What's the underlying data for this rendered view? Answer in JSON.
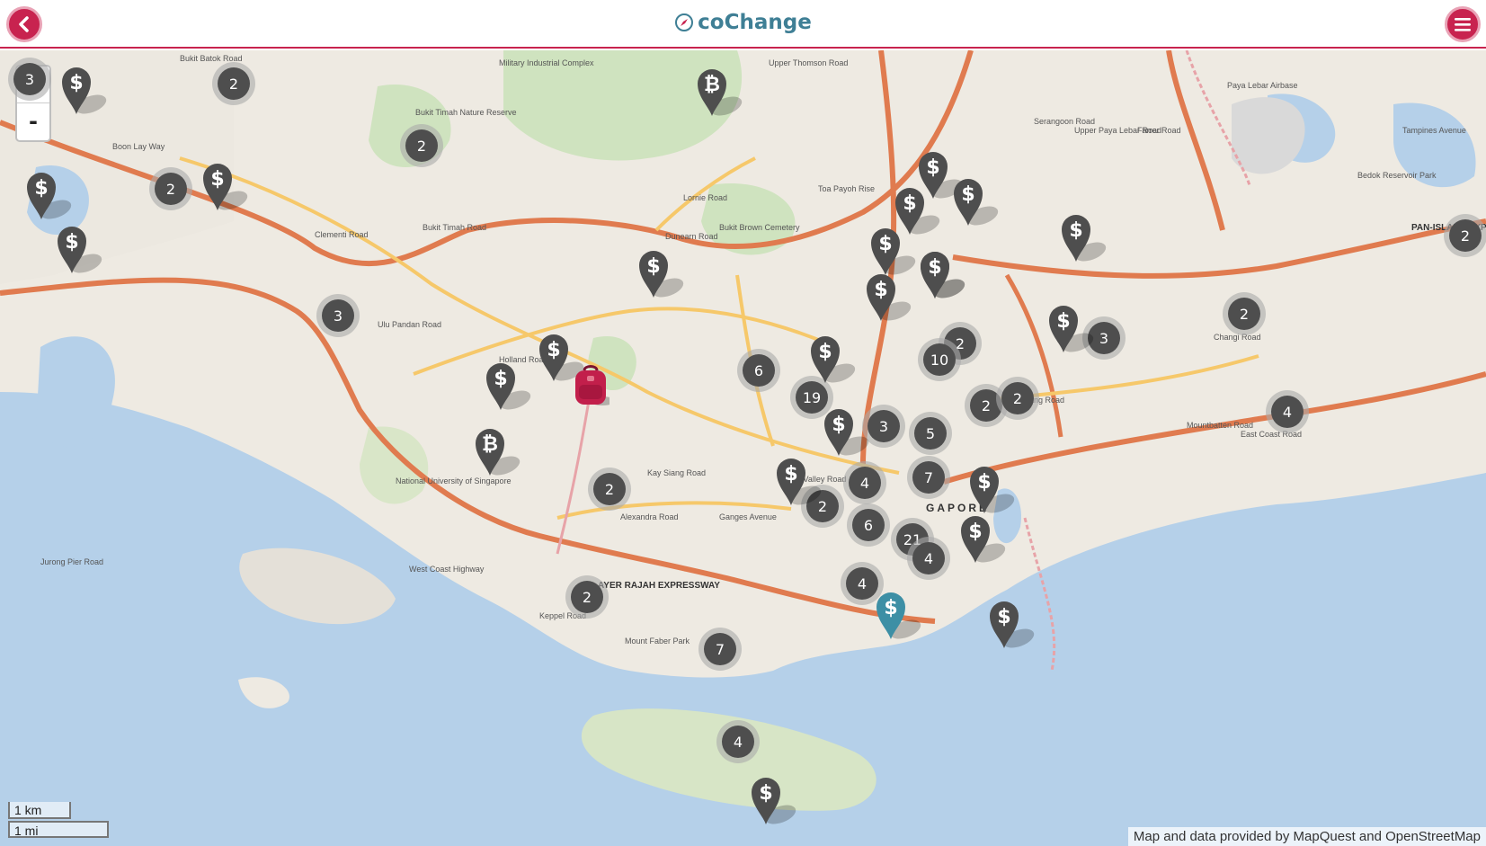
{
  "header": {
    "title": "coChange",
    "back_icon": "back-arrow-icon",
    "menu_icon": "hamburger-menu-icon",
    "accent": "#c8234f",
    "title_color": "#3f7f95"
  },
  "map": {
    "zoom_in": "+",
    "zoom_out": "-",
    "scale_km": "1 km",
    "scale_mi": "1 mi",
    "attribution": "Map and data provided by MapQuest and OpenStreetMap",
    "labels": [
      "Bukit Timah Road",
      "Holland Road",
      "Ulu Pandan Road",
      "Alexandra Road",
      "AYER RAJAH EXPRESSWAY",
      "West Coast Highway",
      "Clementi Road",
      "River Valley Road",
      "Ganges Avenue",
      "Dunearn Road",
      "Bukit Brown Cemetery",
      "PAN-ISLAND EXPRESSWAY",
      "Kallang Road",
      "Mountbatten Road",
      "East Coast Road",
      "Keppel Road",
      "Mount Faber Park",
      "Kay Siang Road",
      "National University of Singapore",
      "GAPORE",
      "Bukit Timah Nature Reserve",
      "Tampines Avenue",
      "Bedok Reservoir Park",
      "Paya Lebar Airbase",
      "Upper Thomson Road",
      "Lornie Road",
      "Serangoon Road",
      "Farrer Road",
      "Boon Lay Way",
      "Jurong Pier Road",
      "Bukit Batok Road",
      "Upper Paya Lebar Road",
      "Changi Road",
      "Toa Payoh Rise",
      "Military Industrial Complex"
    ],
    "clusters": [
      3,
      2,
      2,
      2,
      3,
      2,
      6,
      19,
      3,
      5,
      2,
      10,
      2,
      2,
      3,
      2,
      2,
      4,
      4,
      2,
      6,
      7,
      21,
      4,
      4,
      2,
      7,
      4
    ],
    "markers": [
      {
        "type": "dollar",
        "color": "#4e4e4e"
      },
      {
        "type": "dollar",
        "color": "#4e4e4e"
      },
      {
        "type": "dollar",
        "color": "#4e4e4e"
      },
      {
        "type": "dollar",
        "color": "#4e4e4e"
      },
      {
        "type": "bitcoin",
        "color": "#4e4e4e"
      },
      {
        "type": "dollar",
        "color": "#4e4e4e"
      },
      {
        "type": "dollar",
        "color": "#4e4e4e"
      },
      {
        "type": "dollar",
        "color": "#4e4e4e"
      },
      {
        "type": "bitcoin",
        "color": "#4e4e4e"
      },
      {
        "type": "dollar",
        "color": "#4e4e4e"
      },
      {
        "type": "dollar",
        "color": "#4e4e4e"
      },
      {
        "type": "dollar",
        "color": "#4e4e4e"
      },
      {
        "type": "dollar",
        "color": "#4e4e4e"
      },
      {
        "type": "dollar",
        "color": "#4e4e4e"
      },
      {
        "type": "dollar",
        "color": "#4e4e4e"
      },
      {
        "type": "dollar",
        "color": "#4e4e4e"
      },
      {
        "type": "dollar",
        "color": "#4e4e4e"
      },
      {
        "type": "dollar",
        "color": "#4e4e4e"
      },
      {
        "type": "dollar",
        "color": "#4e4e4e"
      },
      {
        "type": "dollar",
        "color": "#4e4e4e"
      },
      {
        "type": "dollar",
        "color": "#4e4e4e"
      },
      {
        "type": "dollar",
        "color": "#4e4e4e"
      },
      {
        "type": "dollar",
        "color": "#4e4e4e"
      },
      {
        "type": "dollar",
        "color": "#3d8fa5"
      },
      {
        "type": "dollar",
        "color": "#4e4e4e"
      },
      {
        "type": "dollar",
        "color": "#4e4e4e"
      }
    ],
    "user_marker": {
      "icon": "backpack-icon",
      "color": "#c21f4b"
    }
  }
}
